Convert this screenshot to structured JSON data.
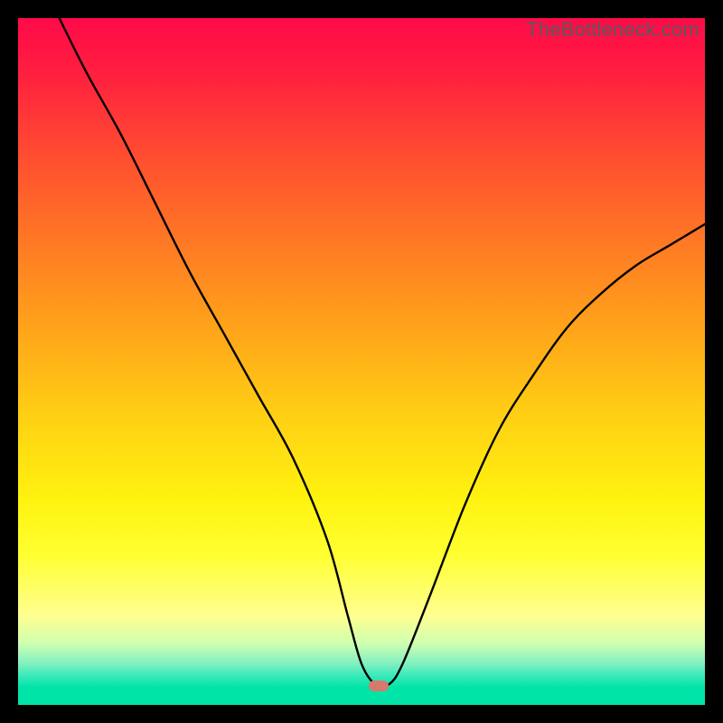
{
  "watermark": "TheBottleneck.com",
  "marker": {
    "x_pct": 52.5,
    "y_pct": 97.2,
    "color": "#d77a6b"
  },
  "chart_data": {
    "type": "line",
    "title": "",
    "xlabel": "",
    "ylabel": "",
    "xlim": [
      0,
      100
    ],
    "ylim": [
      0,
      100
    ],
    "grid": false,
    "legend": false,
    "series": [
      {
        "name": "bottleneck-curve",
        "x": [
          6,
          10,
          15,
          20,
          25,
          30,
          35,
          40,
          45,
          48,
          50,
          52,
          54,
          56,
          60,
          65,
          70,
          75,
          80,
          85,
          90,
          95,
          100
        ],
        "y": [
          100,
          92,
          83,
          73,
          63,
          54,
          45,
          36,
          24,
          13,
          6,
          3,
          3,
          6,
          16,
          29,
          40,
          48,
          55,
          60,
          64,
          67,
          70
        ]
      }
    ],
    "annotations": [
      {
        "text": "TheBottleneck.com",
        "position": "top-right"
      }
    ]
  }
}
